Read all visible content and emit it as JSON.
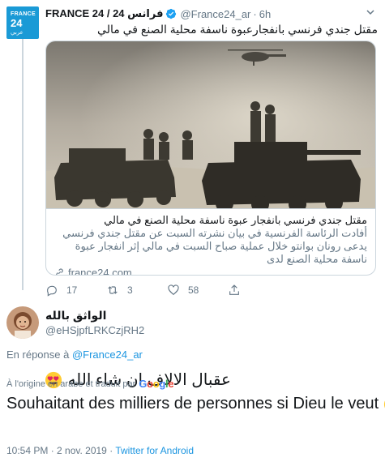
{
  "parent_tweet": {
    "avatar": {
      "line1": "FRANCE",
      "line2": "24",
      "line3": "عربي"
    },
    "display_name": "FRANCE 24 / فرانس 24",
    "handle": "@France24_ar",
    "separator": "·",
    "time": "6h",
    "text": "مقتل جندي فرنسي بانفجارعبوة ناسفة محلية الصنع في مالي",
    "card": {
      "title": "مقتل جندي فرنسي بانفجار عبوة ناسفة محلية الصنع في مالي",
      "description": "أفادت الرئاسة الفرنسية في بيان نشرته السبت عن مقتل جندي فرنسي يدعى رونان بوانتو خلال عملية صباح السبت في مالي إثر انفجار عبوة ناسفة محلية الصنع لدى",
      "domain": "france24.com"
    },
    "actions": {
      "reply_count": "17",
      "retweet_count": "3",
      "like_count": "58"
    }
  },
  "reply_tweet": {
    "display_name": "الواثق بالله",
    "handle": "@eHSjpfLRKCzjRH2",
    "in_reply_prefix": "En réponse à",
    "in_reply_handle": "@France24_ar",
    "text_ar": "عقبال الالاف ان شاء الله",
    "translation_note": "À l'origine en arabe et traduit par",
    "translation_provider": "Google",
    "text_fr": "Souhaitant des milliers de personnes si Dieu le veut",
    "timestamp": "10:54 PM · 2 nov. 2019 · ",
    "source": "Twitter for Android"
  },
  "colors": {
    "link": "#1b95e0",
    "muted": "#657786",
    "border": "#ccd6dd",
    "france24_blue": "#1a9ad6"
  }
}
